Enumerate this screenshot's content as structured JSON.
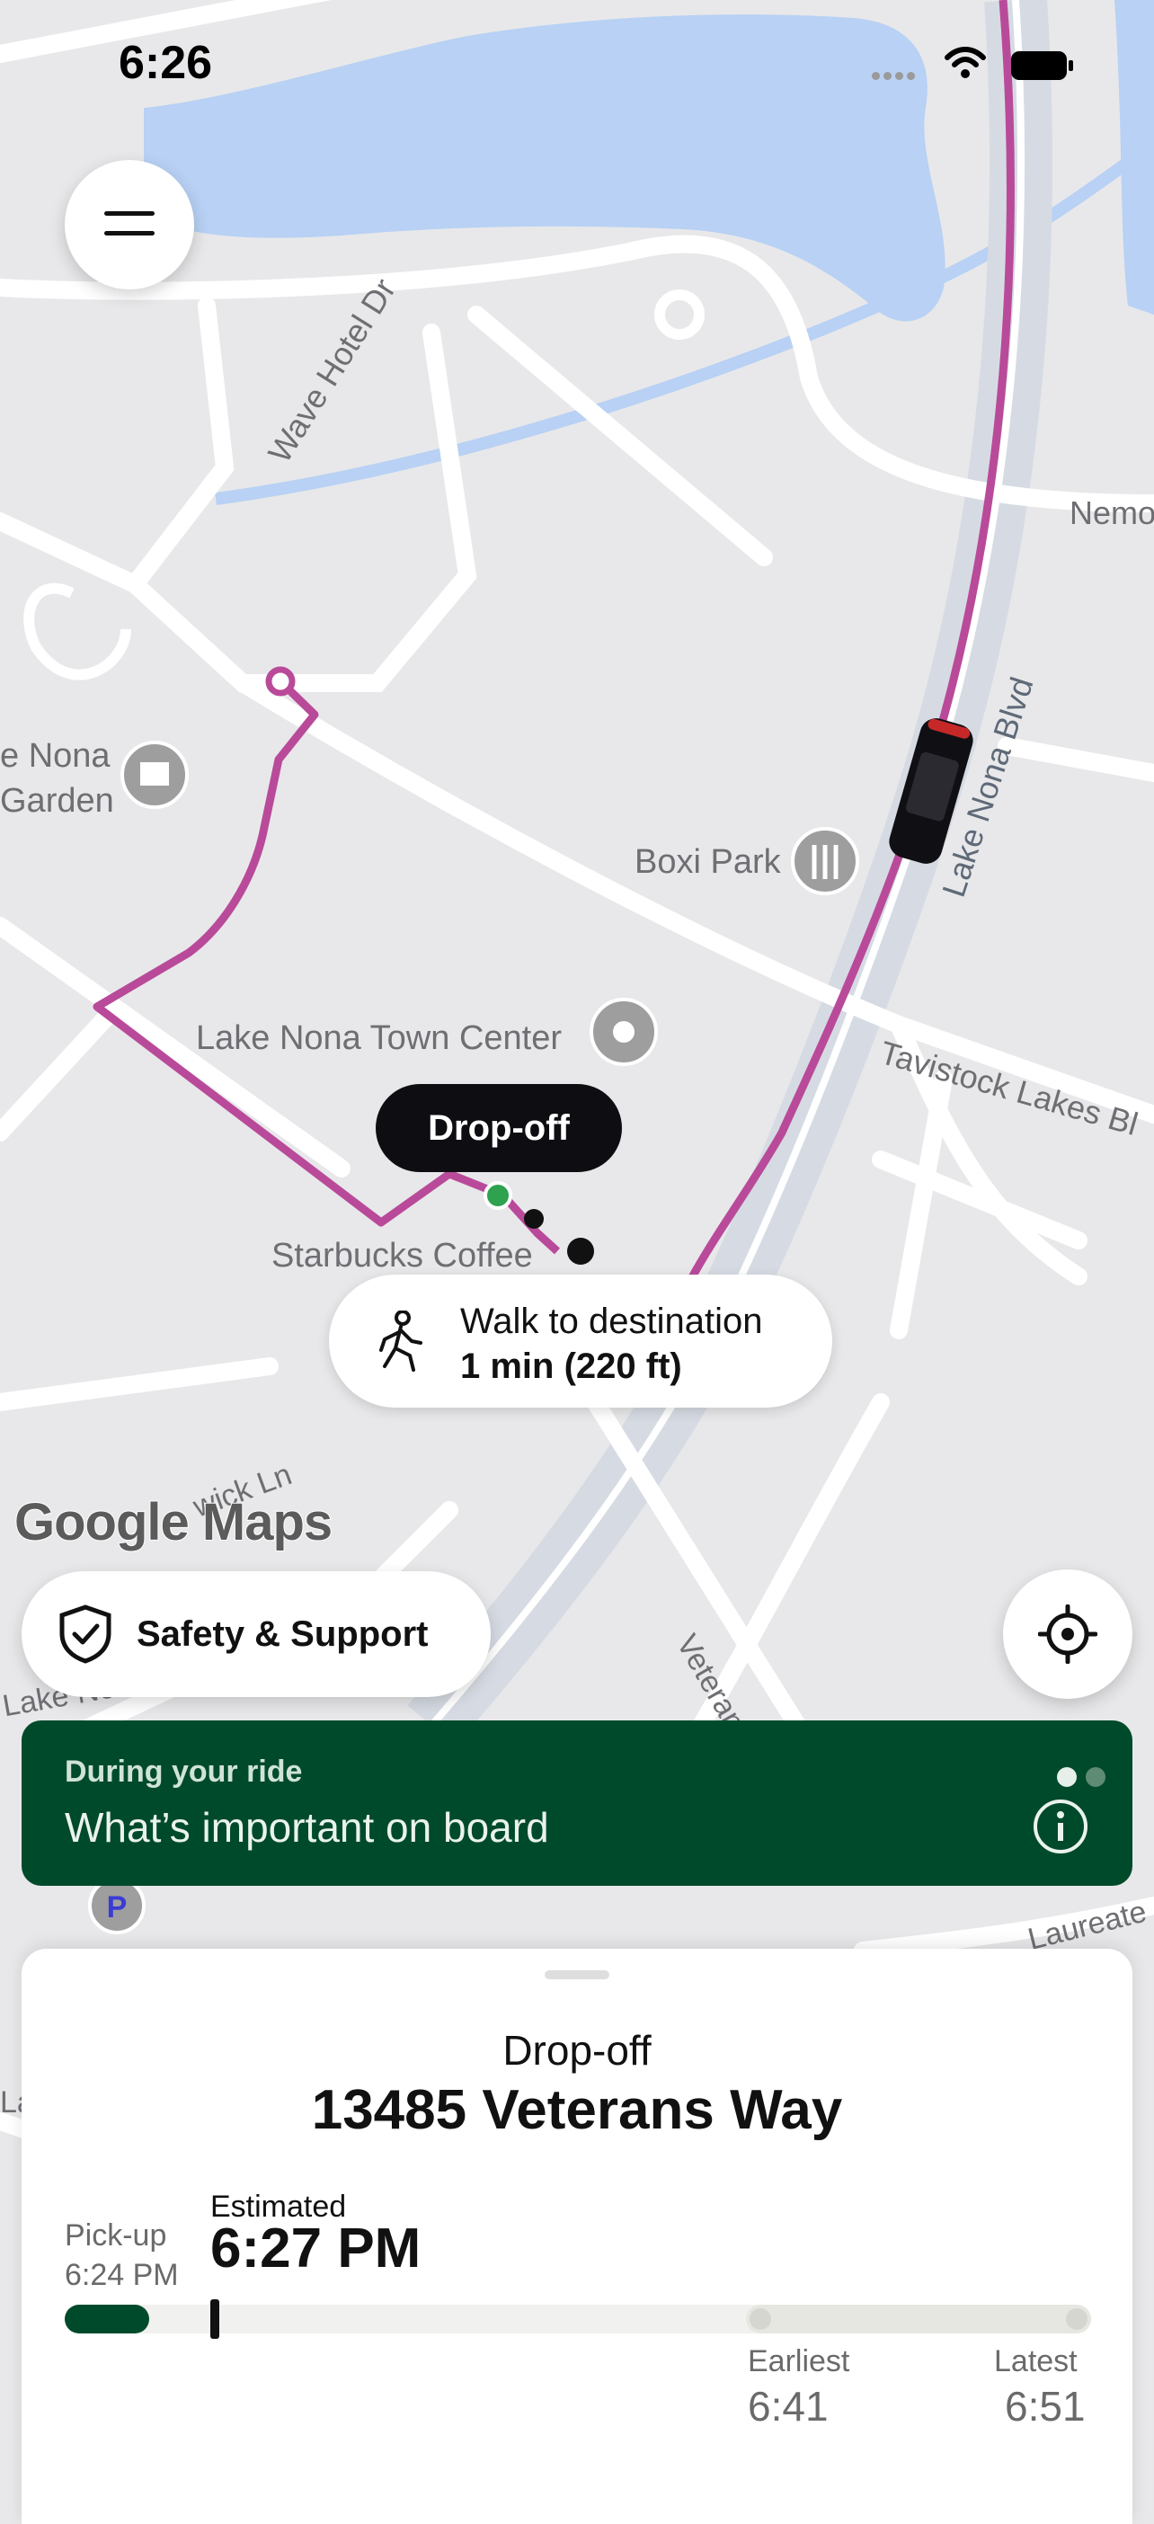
{
  "status_bar": {
    "time": "6:26"
  },
  "map": {
    "labels": {
      "wave_hotel_dr": "Wave Hotel Dr",
      "lake_nona_garden": "e Nona\nGarden",
      "boxi_park": "Boxi Park",
      "lake_nona_town_center": "Lake Nona Town Center",
      "starbucks": "Starbucks Coffee",
      "lake_nona_blvd": "Lake Nona Blvd",
      "tavistock": "Tavistock Lakes Bl",
      "nemours": "Nemo",
      "warwick": "wick Ln",
      "veterans": "Veteran",
      "lake_nona_left": "Lake Non",
      "laureate": "Laureate",
      "la": "La"
    },
    "dropoff_tag": "Drop-off",
    "walk_card": {
      "line1": "Walk to destination",
      "line2": "1 min (220 ft)"
    },
    "attribution": "Google Maps",
    "route_color": "#b94a9a"
  },
  "safety_button": {
    "label": "Safety & Support"
  },
  "banner": {
    "kicker": "During your ride",
    "title": "What’s important on board",
    "color": "#004a2c"
  },
  "trip": {
    "heading": "Drop-off",
    "address": "13485 Veterans Way",
    "pickup_label": "Pick-up",
    "pickup_time": "6:24 PM",
    "estimated_label": "Estimated",
    "estimated_time": "6:27 PM",
    "earliest_label": "Earliest",
    "earliest_time": "6:41",
    "latest_label": "Latest",
    "latest_time": "6:51"
  }
}
